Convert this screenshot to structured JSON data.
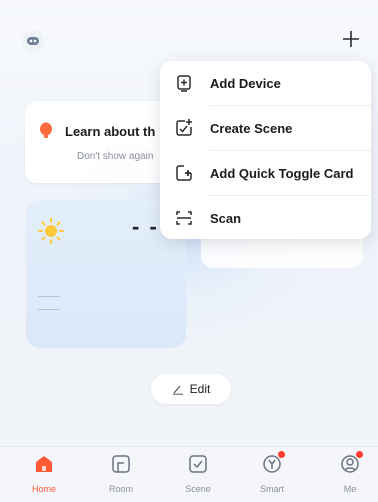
{
  "header": {
    "avatar_icon": "robot-avatar-icon",
    "add_icon": "plus-icon"
  },
  "tip": {
    "title": "Learn about th",
    "subtitle": "Don't show again"
  },
  "weather": {
    "temperature": "- -"
  },
  "menu": {
    "items": [
      {
        "label": "Add Device",
        "icon": "add-device-icon"
      },
      {
        "label": "Create Scene",
        "icon": "create-scene-icon"
      },
      {
        "label": "Add Quick Toggle Card",
        "icon": "add-card-icon"
      },
      {
        "label": "Scan",
        "icon": "scan-icon"
      }
    ]
  },
  "edit": {
    "label": "Edit"
  },
  "tabs": [
    {
      "label": "Home",
      "icon": "home-icon",
      "active": true
    },
    {
      "label": "Room",
      "icon": "room-icon",
      "active": false
    },
    {
      "label": "Scene",
      "icon": "scene-icon",
      "active": false
    },
    {
      "label": "Smart",
      "icon": "smart-icon",
      "active": false,
      "badge": true
    },
    {
      "label": "Me",
      "icon": "me-icon",
      "active": false,
      "badge": true
    }
  ],
  "colors": {
    "accent": "#ff5a36",
    "badge": "#ff3b30",
    "bulb": "#ff6a3d",
    "sun": "#ffc83a"
  }
}
